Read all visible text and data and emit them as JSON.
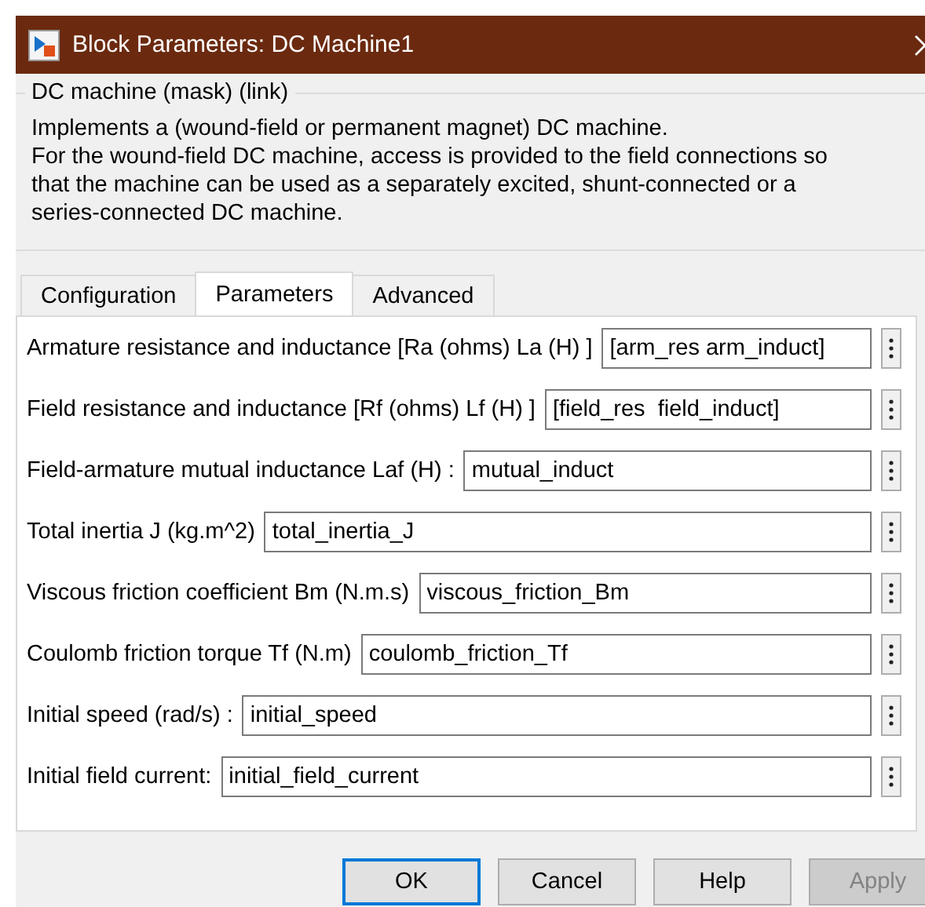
{
  "window": {
    "title": "Block Parameters: DC Machine1"
  },
  "group": {
    "title": "DC machine (mask) (link)",
    "lines": [
      "Implements a (wound-field or permanent magnet) DC machine.",
      "For the wound-field DC machine, access is provided to the field connections so",
      "that the machine can be used as a separately excited, shunt-connected or a",
      "series-connected  DC machine."
    ]
  },
  "tabs": [
    {
      "label": "Configuration",
      "selected": false
    },
    {
      "label": "Parameters",
      "selected": true
    },
    {
      "label": "Advanced",
      "selected": false
    }
  ],
  "parameters": [
    {
      "label": "Armature resistance and inductance [Ra (ohms) La (H) ]",
      "value": "[arm_res arm_induct]"
    },
    {
      "label": "Field resistance and inductance [Rf (ohms) Lf (H) ]",
      "value": "[field_res  field_induct]"
    },
    {
      "label": "Field-armature mutual inductance Laf (H) :",
      "value": "mutual_induct"
    },
    {
      "label": "Total inertia J (kg.m^2)",
      "value": "total_inertia_J"
    },
    {
      "label": "Viscous friction coefficient Bm (N.m.s)",
      "value": "viscous_friction_Bm"
    },
    {
      "label": "Coulomb friction torque Tf (N.m)",
      "value": "coulomb_friction_Tf"
    },
    {
      "label": "Initial speed (rad/s) :",
      "value": "initial_speed"
    },
    {
      "label": "Initial field current:",
      "value": "initial_field_current"
    }
  ],
  "buttons": [
    {
      "label": "OK",
      "default": true,
      "disabled": false
    },
    {
      "label": "Cancel",
      "default": false,
      "disabled": false
    },
    {
      "label": "Help",
      "default": false,
      "disabled": false
    },
    {
      "label": "Apply",
      "default": false,
      "disabled": true
    }
  ]
}
